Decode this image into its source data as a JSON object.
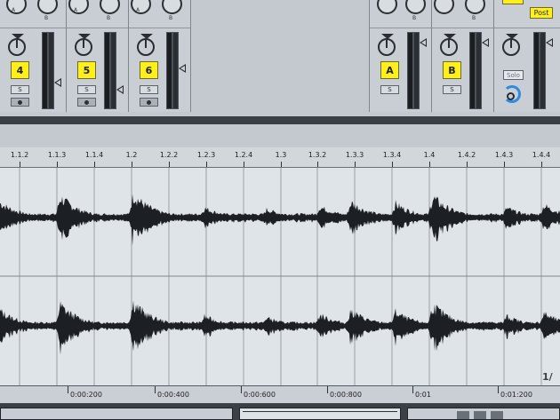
{
  "mixer": {
    "tracks": [
      {
        "id": "track-4",
        "label": "4",
        "solo": "S"
      },
      {
        "id": "track-5",
        "label": "5",
        "solo": "S"
      },
      {
        "id": "track-6",
        "label": "6",
        "solo": "S"
      }
    ],
    "returns": [
      {
        "id": "return-a",
        "label": "A",
        "solo": "S"
      },
      {
        "id": "return-b",
        "label": "B",
        "solo": "S"
      }
    ],
    "send_labels": {
      "a": "A",
      "b": "B"
    },
    "master": {
      "post_label": "Post",
      "solo_label": "Solo"
    }
  },
  "ruler": {
    "ticks": [
      "1.1.2",
      "1.1.3",
      "1.1.4",
      "1.2",
      "1.2.2",
      "1.2.3",
      "1.2.4",
      "1.3",
      "1.3.2",
      "1.3.3",
      "1.3.4",
      "1.4",
      "1.4.2",
      "1.4.3",
      "1.4.4"
    ]
  },
  "timeline": {
    "ticks": [
      "0:00:200",
      "0:00:400",
      "0:00:600",
      "0:00:800",
      "0:01",
      "0:01:200"
    ]
  },
  "page_indicator": "1/",
  "colors": {
    "track_label_bg": "#ffef1a",
    "waveform": "#1c2024",
    "waveform_bg": "#dfe4e9",
    "separator_bar": "#3a3f45"
  }
}
